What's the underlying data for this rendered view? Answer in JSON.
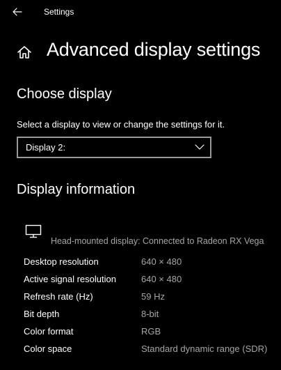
{
  "window": {
    "app_title": "Settings",
    "back_icon": "back-arrow-icon"
  },
  "page": {
    "title": "Advanced display settings",
    "home_icon": "home-icon"
  },
  "choose_display": {
    "heading": "Choose display",
    "description": "Select a display to view or change the settings for it.",
    "dropdown": {
      "selected": "Display 2:",
      "icon": "chevron-down-icon"
    }
  },
  "display_information": {
    "heading": "Display information",
    "device_icon": "monitor-icon",
    "device": "Head-mounted display: Connected to Radeon RX Vega",
    "rows": [
      {
        "label": "Desktop resolution",
        "value": "640 × 480"
      },
      {
        "label": "Active signal resolution",
        "value": "640 × 480"
      },
      {
        "label": "Refresh rate (Hz)",
        "value": "59 Hz"
      },
      {
        "label": "Bit depth",
        "value": "8-bit"
      },
      {
        "label": "Color format",
        "value": "RGB"
      },
      {
        "label": "Color space",
        "value": "Standard dynamic range (SDR)"
      }
    ]
  },
  "colors": {
    "background": "#000000",
    "text": "#ffffff",
    "secondary_text": "#a6a6a6",
    "dropdown_border": "#999999"
  }
}
